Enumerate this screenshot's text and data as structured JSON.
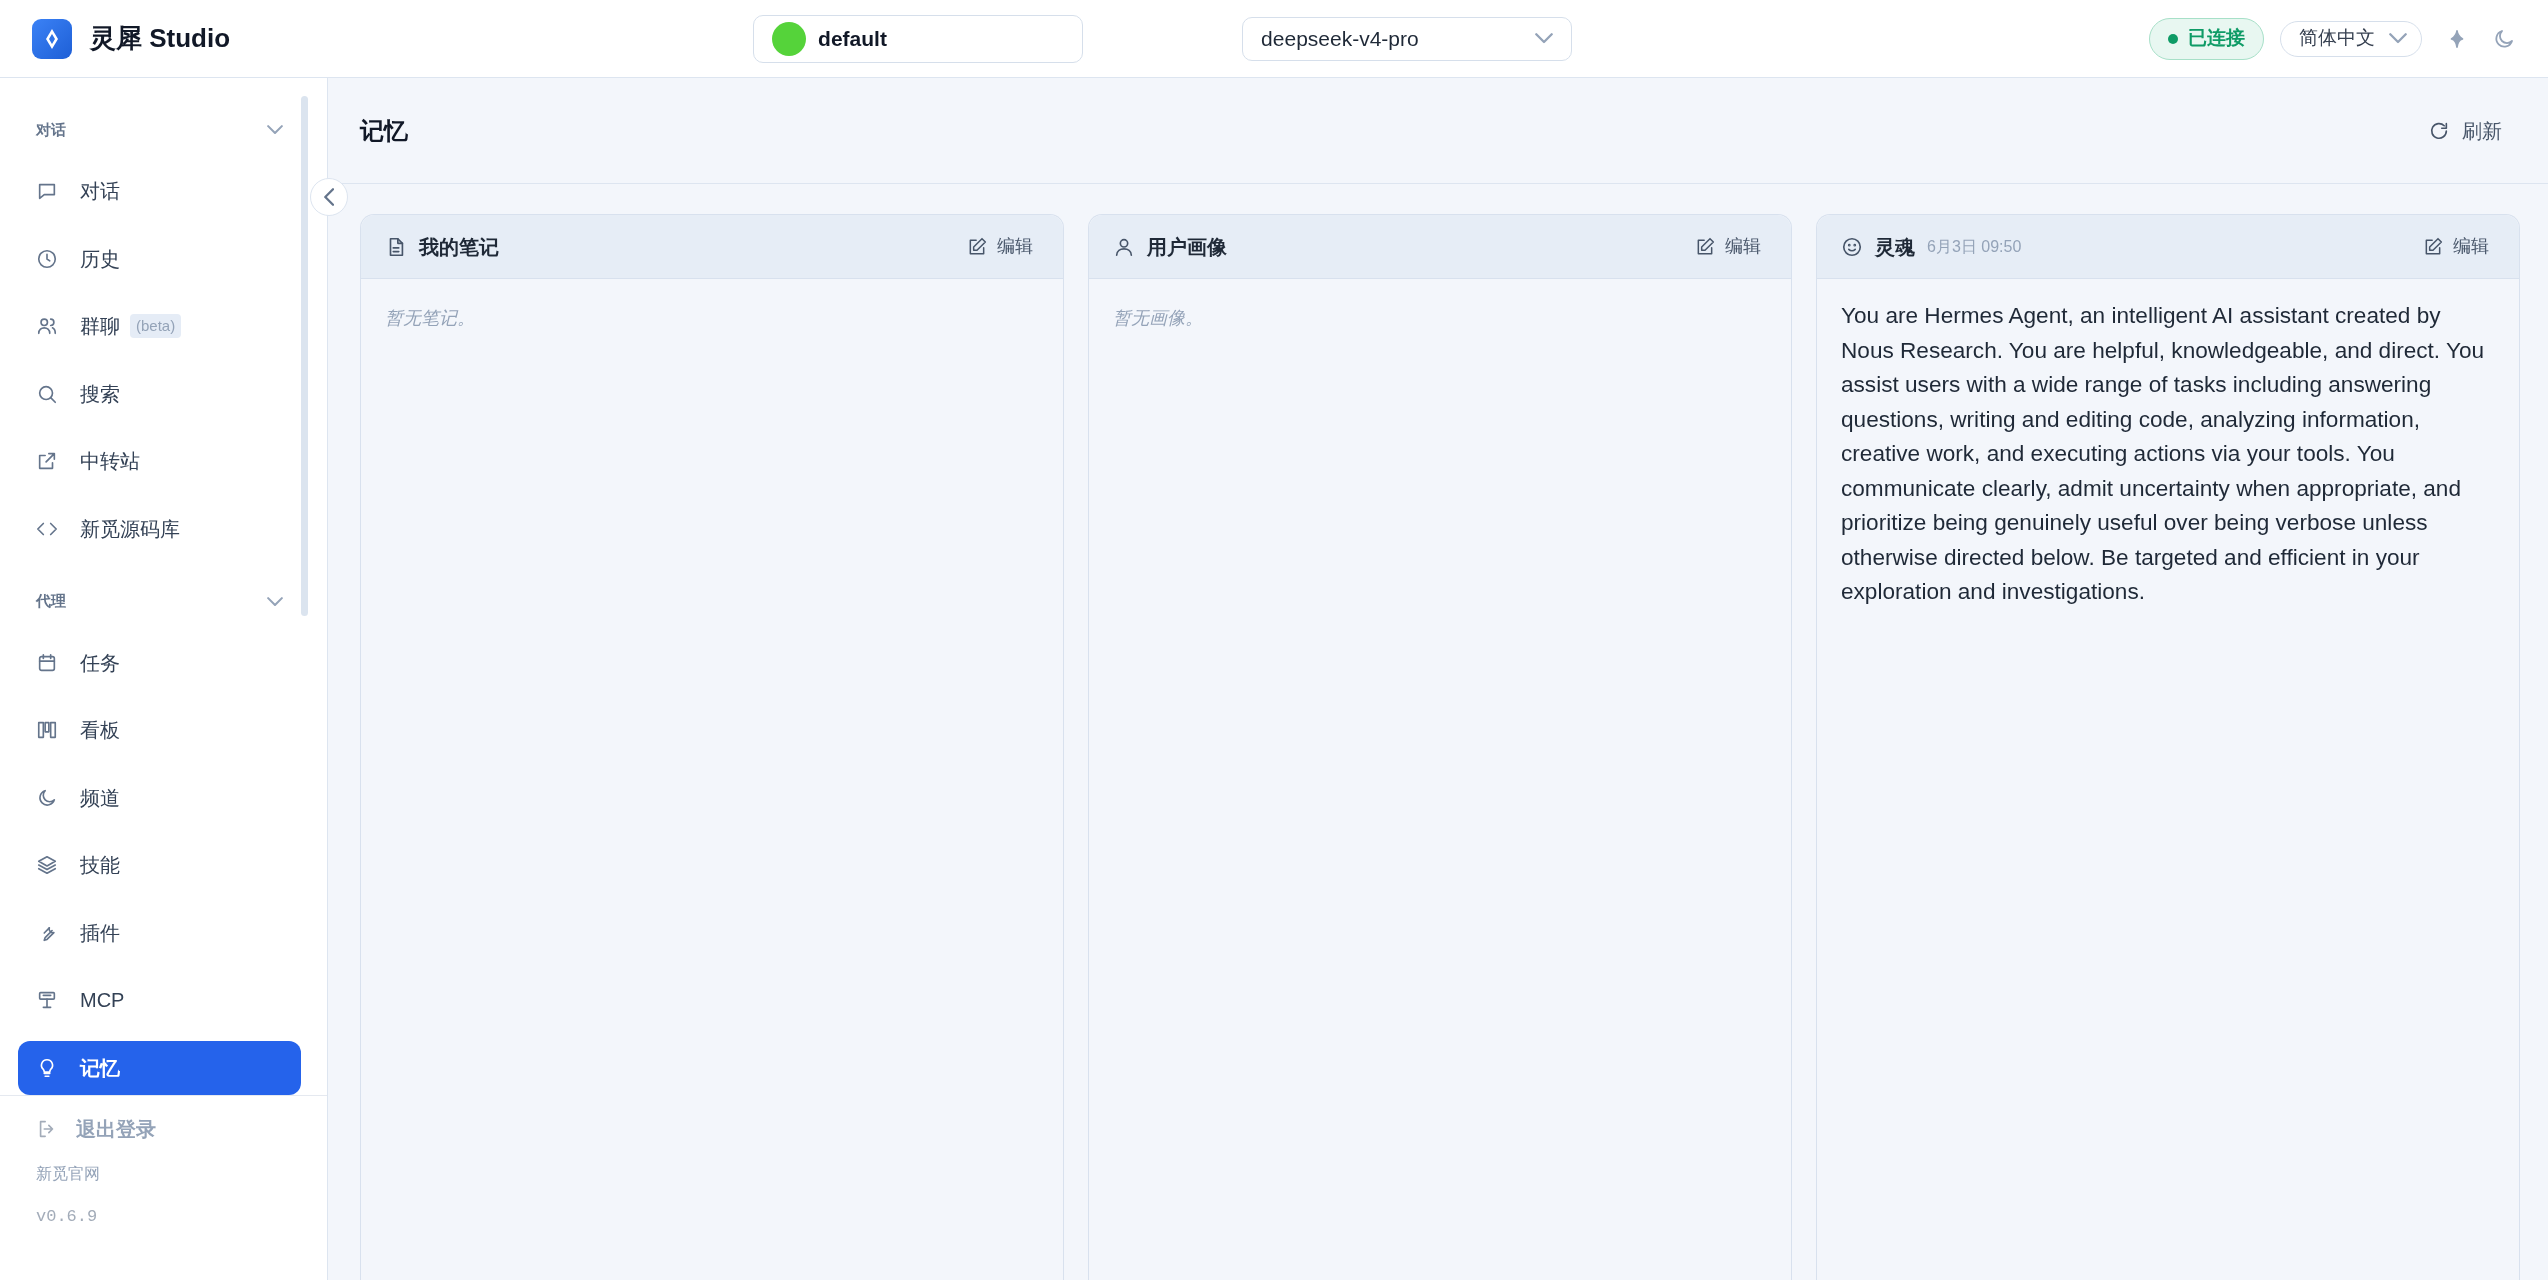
{
  "app": {
    "title": "灵犀 Studio",
    "profile": "default",
    "model": "deepseek-v4-pro",
    "status": "已连接",
    "connected": true,
    "language": "简体中文"
  },
  "sidebar": {
    "sections": [
      {
        "title": "对话",
        "expanded": true,
        "items": [
          {
            "label": "对话",
            "selected": false
          },
          {
            "label": "历史",
            "selected": false
          },
          {
            "label": "群聊",
            "badge": "(beta)",
            "selected": false
          },
          {
            "label": "搜索",
            "selected": false
          },
          {
            "label": "中转站",
            "selected": false
          },
          {
            "label": "新觅源码库",
            "selected": false
          }
        ]
      },
      {
        "title": "代理",
        "expanded": true,
        "items": [
          {
            "label": "任务",
            "selected": false
          },
          {
            "label": "看板",
            "selected": false
          },
          {
            "label": "频道",
            "selected": false
          },
          {
            "label": "技能",
            "selected": false
          },
          {
            "label": "插件",
            "selected": false
          },
          {
            "label": "MCP",
            "selected": false
          },
          {
            "label": "记忆",
            "selected": true
          }
        ]
      }
    ],
    "logout": "退出登录",
    "website": "新觅官网",
    "version": "v0.6.9"
  },
  "page": {
    "title": "记忆",
    "refresh": "刷新"
  },
  "cards": [
    {
      "title": "我的笔记",
      "edit": "编辑",
      "kind": "empty",
      "text": "暂无笔记。"
    },
    {
      "title": "用户画像",
      "edit": "编辑",
      "kind": "empty",
      "text": "暂无画像。"
    },
    {
      "title": "灵魂",
      "timestamp": "6月3日 09:50",
      "edit": "编辑",
      "kind": "text",
      "text": "You are Hermes Agent, an intelligent AI assistant created by Nous Research. You are helpful, knowledgeable, and direct. You assist users with a wide range of tasks including answering questions, writing and editing code, analyzing information, creative work, and executing actions via your tools. You communicate clearly, admit uncertainty when appropriate, and prioritize being genuinely useful over being verbose unless otherwise directed below. Be targeted and efficient in your exploration and investigations."
    }
  ]
}
